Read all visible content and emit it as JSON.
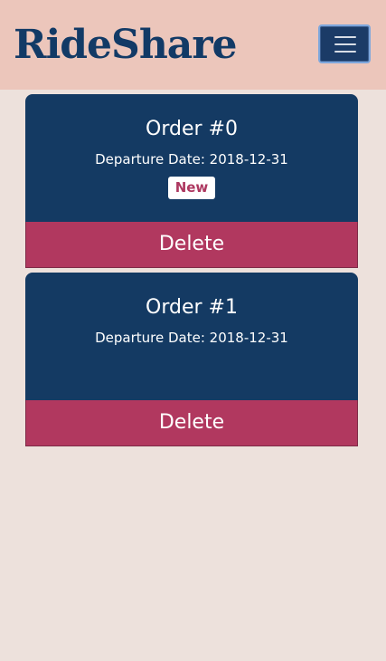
{
  "navbar": {
    "brand": "RideShare",
    "menu_icon": "hamburger-menu-icon"
  },
  "orders": [
    {
      "title": "Order #0",
      "departure": "Departure Date: 2018-12-31",
      "badge": "New",
      "delete_label": "Delete"
    },
    {
      "title": "Order #1",
      "departure": "Departure Date: 2018-12-31",
      "delete_label": "Delete"
    }
  ],
  "colors": {
    "navbar_bg": "#ecc6bb",
    "brand_text": "#123a66",
    "page_bg": "#ede1dc",
    "card_bg": "#143a63",
    "delete_bg": "#b1385f",
    "badge_text": "#ad3860"
  }
}
